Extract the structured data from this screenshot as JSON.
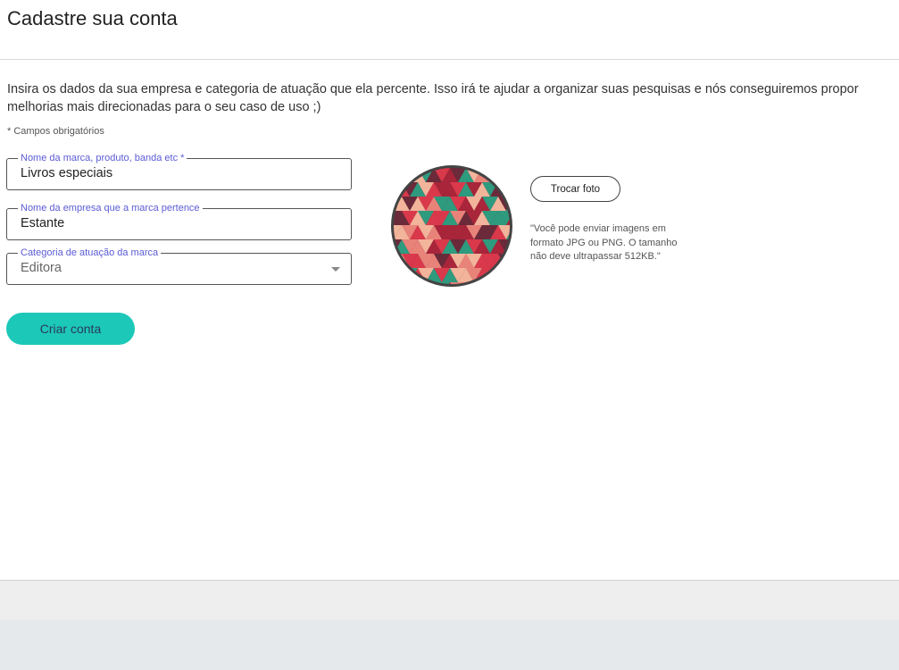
{
  "header": {
    "title": "Cadastre sua conta"
  },
  "intro": {
    "text": "Insira os dados da sua empresa e categoria de atuação que ela percente. Isso irá te ajudar a organizar suas pesquisas e nós conseguiremos propor melhorias mais direcionadas para o seu caso de uso ;)",
    "required_note": "* Campos obrigatórios"
  },
  "form": {
    "brand_name": {
      "label": "Nome da marca, produto, banda etc *",
      "value": "Livros especiais"
    },
    "company_name": {
      "label": "Nome da empresa que a marca pertence",
      "value": "Estante"
    },
    "category": {
      "label": "Categoria de atuação da marca",
      "value": "Editora"
    },
    "submit_label": "Criar conta"
  },
  "photo": {
    "button_label": "Trocar foto",
    "help_text": "\"Você pode enviar imagens em formato JPG ou PNG. O tamanho não deve ultrapassar 512KB.\""
  },
  "colors": {
    "accent": "#1cc8b8",
    "label": "#5b5bd6",
    "pattern": [
      "#d9394b",
      "#f2b49a",
      "#2e9a7e",
      "#6a2a3a",
      "#e8837a",
      "#a8253a"
    ]
  }
}
